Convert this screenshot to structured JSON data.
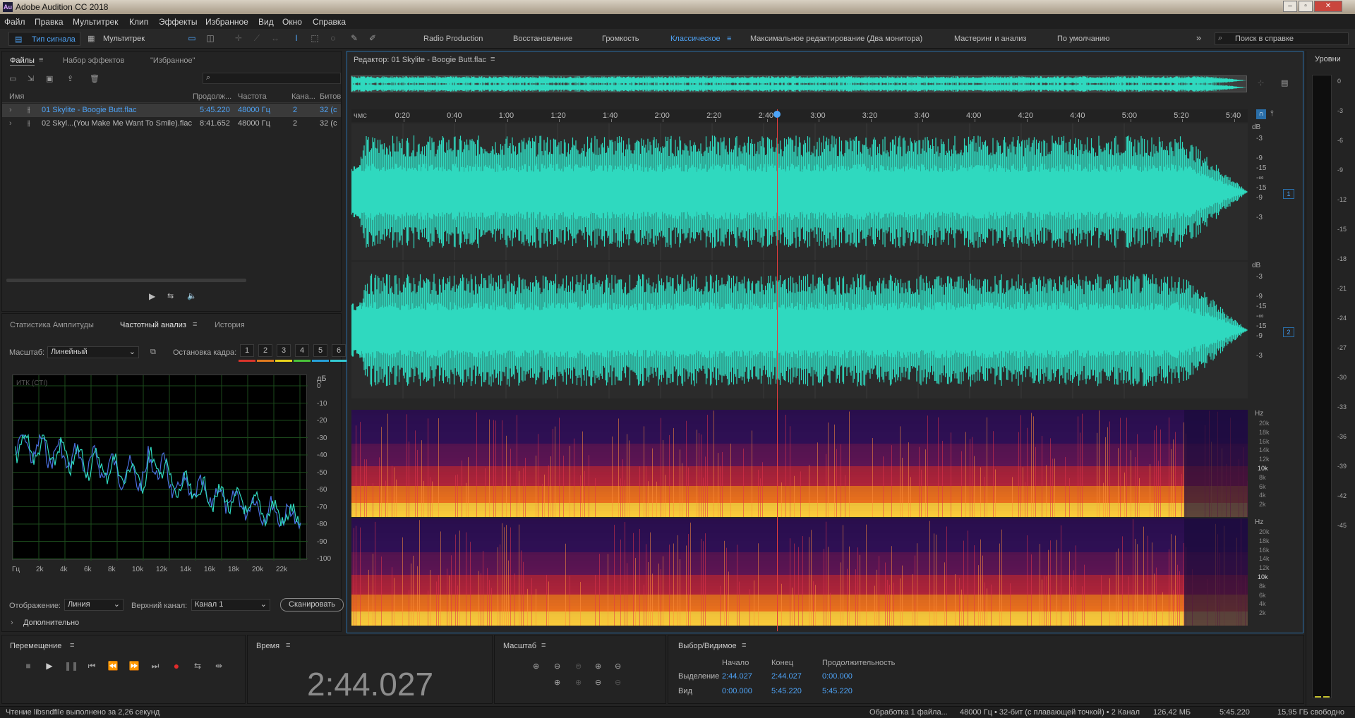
{
  "app": {
    "title": "Adobe Audition CC 2018",
    "icon_text": "Au"
  },
  "menu": [
    "Файл",
    "Правка",
    "Мультитрек",
    "Клип",
    "Эффекты",
    "Избранное",
    "Вид",
    "Окно",
    "Справка"
  ],
  "toolbar": {
    "waveform_label": "Тип сигнала",
    "multitrack_label": "Мультитрек",
    "workspaces": [
      "Radio Production",
      "Восстановление",
      "Громкость",
      "Классическое",
      "Максимальное редактирование (Два монитора)",
      "Мастеринг и анализ",
      "По умолчанию"
    ],
    "active_workspace": "Классическое",
    "search_placeholder": "Поиск в справке"
  },
  "files_panel": {
    "tabs": [
      "Файлы",
      "Набор эффектов",
      "\"Избранное\""
    ],
    "columns": [
      "Имя",
      "Продолж...",
      "Частота",
      "Кана...",
      "Битов"
    ],
    "rows": [
      {
        "name": "01 Skylite - Boogie Butt.flac",
        "duration": "5:45.220",
        "rate": "48000 Гц",
        "channels": "2",
        "bits": "32 (с"
      },
      {
        "name": "02 Skyl...(You Make Me Want To Smile).flac",
        "duration": "8:41.652",
        "rate": "48000 Гц",
        "channels": "2",
        "bits": "32 (с"
      }
    ]
  },
  "analysis_panel": {
    "tabs": [
      "Статистика Амплитуды",
      "Частотный анализ",
      "История"
    ],
    "scale_label": "Масштаб:",
    "scale_value": "Линейный",
    "freeze_label": "Остановка кадра:",
    "freeze_buttons": [
      "1",
      "2",
      "3",
      "4",
      "5",
      "6"
    ],
    "freeze_colors": [
      "#d9342b",
      "#e07a1f",
      "#e8d21c",
      "#49c23a",
      "#26a0d8",
      "#33c9d1"
    ],
    "plot_label": "ИТК (СТІ)",
    "db_unit": "дБ",
    "db_ticks": [
      "0",
      "-10",
      "-20",
      "-30",
      "-40",
      "-50",
      "-60",
      "-70",
      "-80",
      "-90",
      "-100"
    ],
    "freq_ticks": [
      "Гц",
      "2k",
      "4k",
      "6k",
      "8k",
      "10k",
      "12k",
      "14k",
      "16k",
      "18k",
      "20k",
      "22k"
    ],
    "display_label": "Отображение:",
    "display_value": "Линия",
    "channel_label": "Верхний канал:",
    "channel_value": "Канал 1",
    "scan_button": "Сканировать",
    "advanced_label": "Дополнительно"
  },
  "editor": {
    "title": "Редактор: 01 Skylite - Boogie Butt.flac",
    "ruler_unit": "чмс",
    "ruler_ticks": [
      "0:20",
      "0:40",
      "1:00",
      "1:20",
      "1:40",
      "2:00",
      "2:20",
      "2:40",
      "3:00",
      "3:20",
      "3:40",
      "4:00",
      "4:20",
      "4:40",
      "5:00",
      "5:20",
      "5:40"
    ],
    "db_unit": "dB",
    "db_ticks": [
      "-3",
      "-9",
      "-15",
      "-∞",
      "-15",
      "-9",
      "-3"
    ],
    "channel_badges": [
      "1",
      "2"
    ],
    "hz_unit": "Hz",
    "hz_ticks": [
      "20k",
      "18k",
      "16k",
      "14k",
      "12k",
      "10k",
      "8k",
      "6k",
      "4k",
      "2k"
    ],
    "waveform_color": "#2fd9bf",
    "playhead_fraction": 0.475
  },
  "levels": {
    "title": "Уровни",
    "ticks": [
      "0",
      "-3",
      "-6",
      "-9",
      "-12",
      "-15",
      "-18",
      "-21",
      "-24",
      "-27",
      "-30",
      "-33",
      "-36",
      "-39",
      "-42",
      "-45"
    ]
  },
  "transport": {
    "title": "Перемещение"
  },
  "time": {
    "title": "Время",
    "value": "2:44.027"
  },
  "zoom": {
    "title": "Масштаб"
  },
  "selection": {
    "title": "Выбор/Видимое",
    "headers": [
      "Начало",
      "Конец",
      "Продолжительность"
    ],
    "rows": [
      {
        "label": "Выделение",
        "start": "2:44.027",
        "end": "2:44.027",
        "duration": "0:00.000"
      },
      {
        "label": "Вид",
        "start": "0:00.000",
        "end": "5:45.220",
        "duration": "5:45.220"
      }
    ]
  },
  "status": {
    "left": "Чтение libsndfile выполнено за 2,26 секунд",
    "processing": "Обработка 1 файла...",
    "format": "48000 Гц • 32-бит (с плавающей точкой) • 2 Канал",
    "size": "126,42 МБ",
    "duration": "5:45.220",
    "free": "15,95 ГБ свободно"
  }
}
